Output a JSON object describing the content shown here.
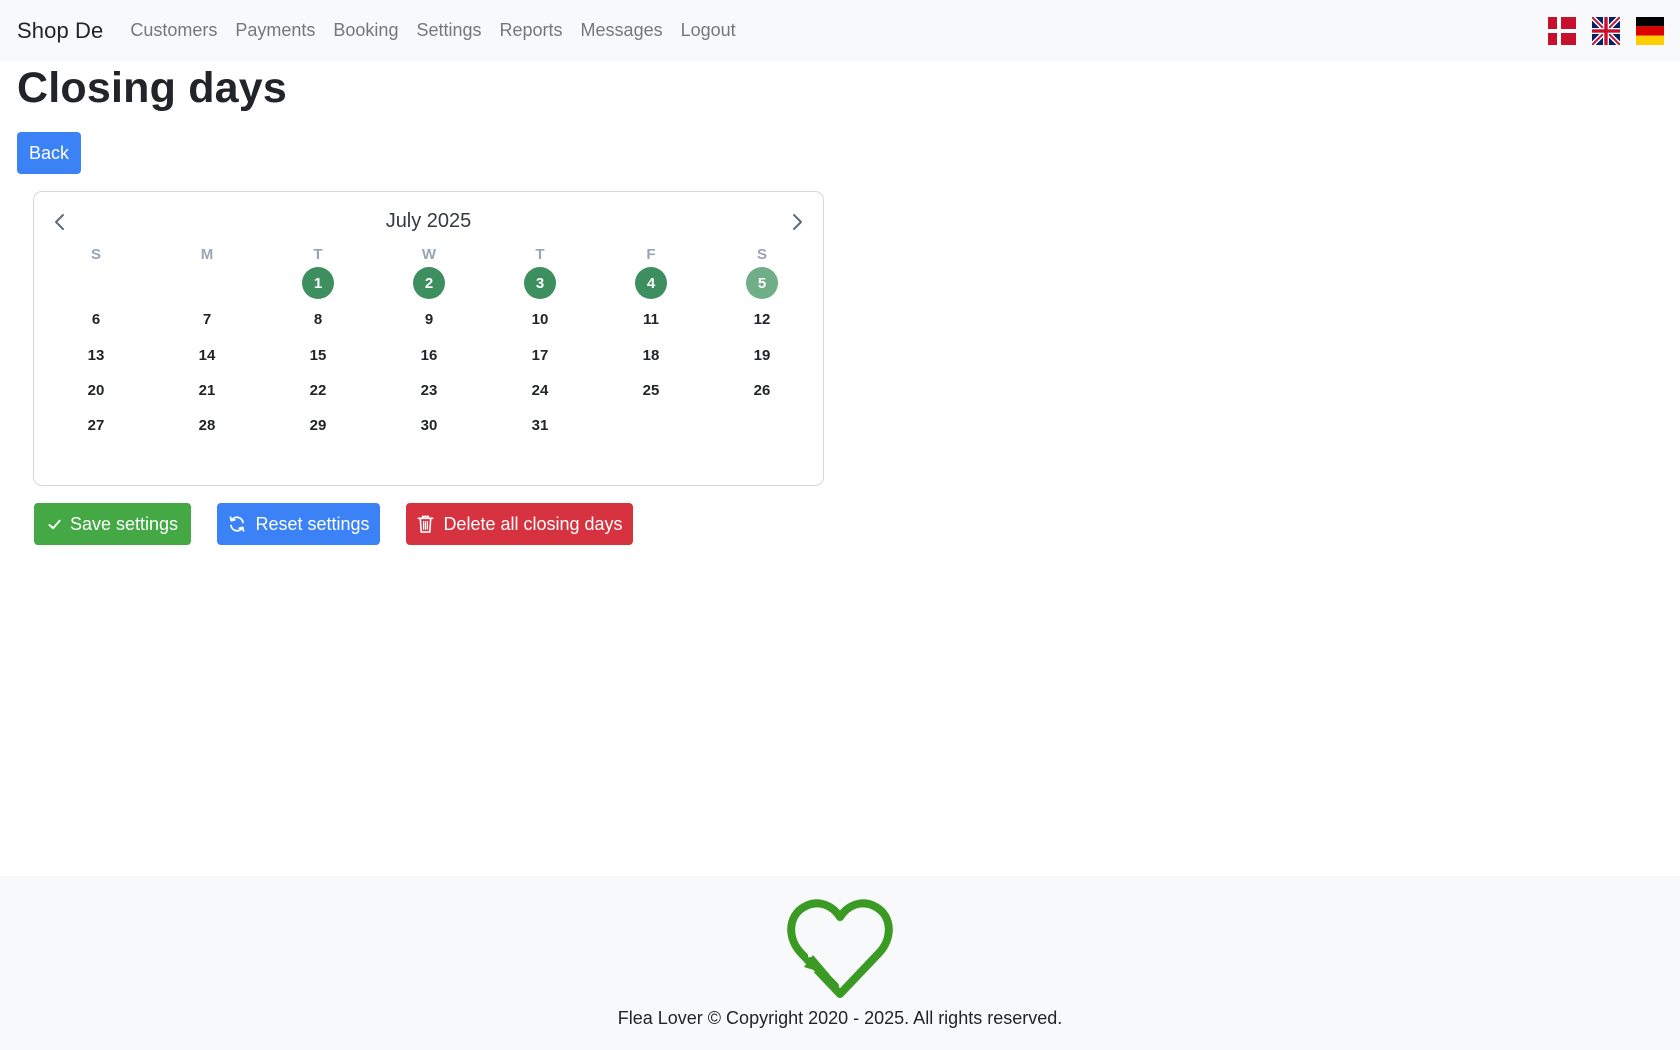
{
  "nav": {
    "brand": "Shop De",
    "links": [
      "Customers",
      "Payments",
      "Booking",
      "Settings",
      "Reports",
      "Messages",
      "Logout"
    ],
    "flags": [
      "danish-flag-icon",
      "uk-flag-icon",
      "german-flag-icon"
    ]
  },
  "page": {
    "title": "Closing days",
    "back_label": "Back"
  },
  "calendar": {
    "month_label": "July 2025",
    "weekdays": [
      "S",
      "M",
      "T",
      "W",
      "T",
      "F",
      "S"
    ],
    "first_weekday_index": 2,
    "days_in_month": 31,
    "closed_days": [
      1,
      2,
      3,
      4,
      5
    ],
    "highlighted_light_days": [
      5
    ],
    "closed_color": "#3d8f5f",
    "closed_light_color": "#6fae86",
    "prev_icon": "chevron-left-icon",
    "next_icon": "chevron-right-icon"
  },
  "actions": {
    "save_label": "Save settings",
    "reset_label": "Reset settings",
    "delete_label": "Delete all closing days",
    "save_color": "#44a844",
    "reset_color": "#3b82f6",
    "delete_color": "#d7323f"
  },
  "footer": {
    "copyright": "Flea Lover © Copyright 2020 - 2025. All rights reserved.",
    "logo_icon": "recycle-heart-icon",
    "logo_color": "#3a9a23"
  }
}
